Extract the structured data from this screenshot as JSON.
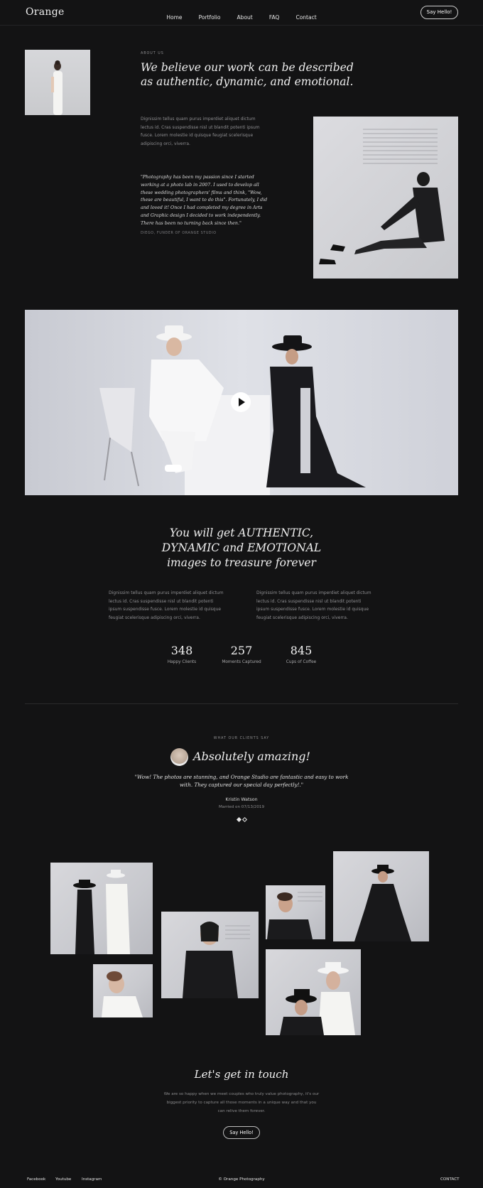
{
  "brand": "Orange",
  "nav": [
    "Home",
    "Portfolio",
    "About",
    "FAQ",
    "Contact"
  ],
  "header_cta": "Say Hello!",
  "about": {
    "eyebrow": "ABOUT US",
    "heading": "We believe our work can be described as authentic, dynamic, and emotional.",
    "paragraph": "Dignissim tellus quam purus imperdiet aliquet dictum lectus id. Cras suspendisse nisl ut blandit potenti ipsum fusce. Lorem molestie id quisque feugiat scelerisque adipiscing orci, viverra.",
    "quote": "\"Photography has been my passion since I started working at a photo lab in 2007. I used to develop all these wedding photographers' films and think, \"Wow, these are beautiful, I want to do this\". Fortunately, I did and loved it! Once I had completed my degree in Arts and Graphic design I decided to work independently. There has been no turning back since then.\"",
    "founder": "DIEGO, FUNDER OF ORANGE STUDIO"
  },
  "promise": {
    "heading_lines": [
      "You will get AUTHENTIC,",
      "DYNAMIC and EMOTIONAL",
      "images to treasure forever"
    ],
    "col1": "Dignissim tellus quam purus imperdiet aliquet dictum lectus id. Cras suspendisse nisl ut blandit potenti ipsum suspendisse fusce. Lorem molestie id quisque feugiat scelerisque adipiscing orci, viverra.",
    "col2": "Dignissim tellus quam purus imperdiet aliquet dictum lectus id. Cras suspendisse nisl ut blandit potenti ipsum suspendisse fusce. Lorem molestie id quisque feugiat scelerisque adipiscing orci, viverra."
  },
  "stats": [
    {
      "value": "348",
      "label": "Happy Clients"
    },
    {
      "value": "257",
      "label": "Moments Captured"
    },
    {
      "value": "845",
      "label": "Cups of Coffee"
    }
  ],
  "testimonial": {
    "eyebrow": "WHAT OUR CLIENTS SAY",
    "heading": "Absolutely amazing!",
    "quote": "\"Wow! The photos are stunning, and Orange Studio are fantastic and easy to work with. They captured our special day perfectly!.\"",
    "name": "Kristin Watson",
    "date": "Married on 07/13/2019"
  },
  "contact": {
    "heading": "Let's get in touch",
    "paragraph": "We are so happy when we meet couples who truly value photography, it's our biggest priority to capture all those moments in a unique way and that you can relive them forever.",
    "cta": "Say Hello!"
  },
  "footer": {
    "links": [
      "Facebook",
      "Youtube",
      "Instagram"
    ],
    "copyright": "© Orange Photography",
    "contact": "CONTACT"
  },
  "colors": {
    "background": "#131314",
    "text": "#f0f0f0",
    "muted": "#8f8f92"
  }
}
